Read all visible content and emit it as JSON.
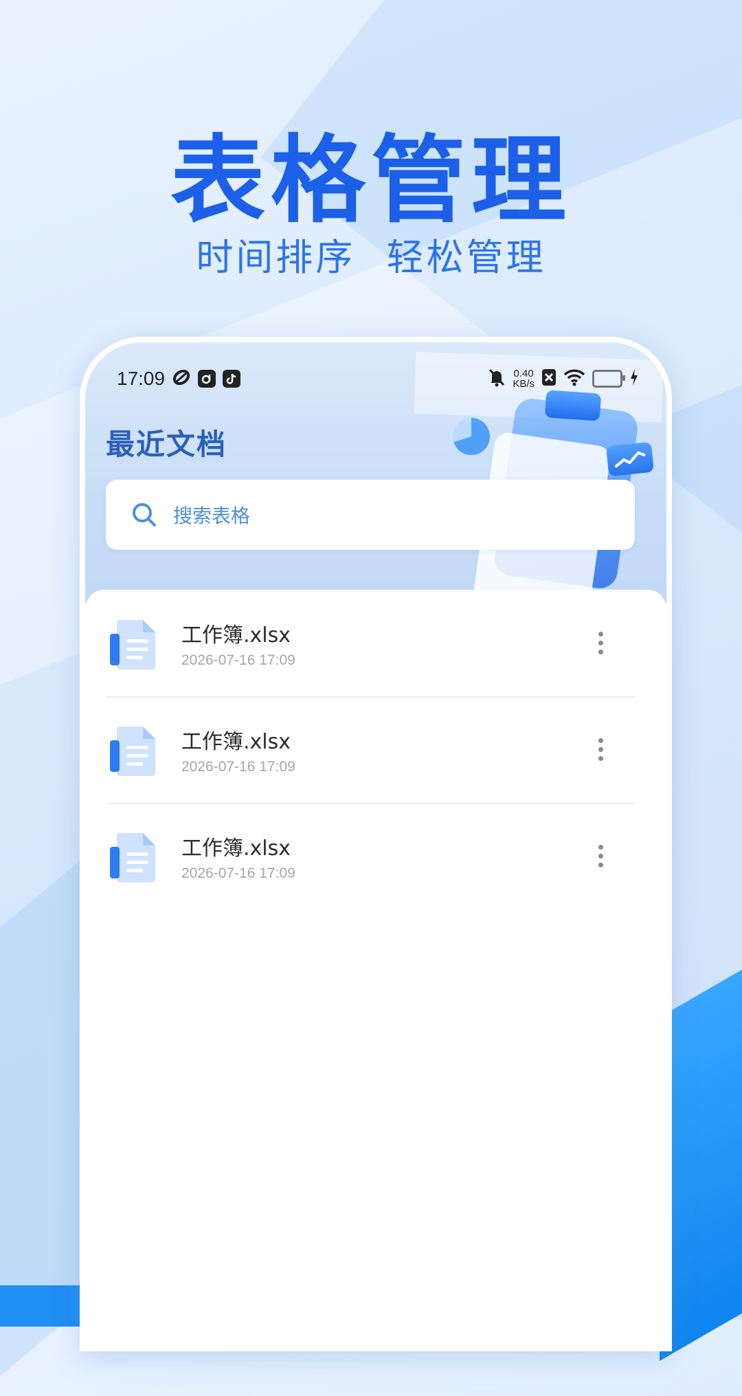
{
  "promo": {
    "headline": "表格管理",
    "subline": "时间排序  轻松管理"
  },
  "status_bar": {
    "time": "17:09",
    "net_speed_value": "0.40",
    "net_speed_unit": "KB/s",
    "icons": [
      "sync-icon",
      "app-icon",
      "tiktok-icon",
      "mute-icon",
      "sim-icon",
      "wifi-icon",
      "battery-icon",
      "charging-icon"
    ]
  },
  "page": {
    "title": "最近文档"
  },
  "search": {
    "placeholder": "搜索表格"
  },
  "files": [
    {
      "name": "工作簿.xlsx",
      "date": "2026-07-16 17:09"
    },
    {
      "name": "工作簿.xlsx",
      "date": "2026-07-16 17:09"
    },
    {
      "name": "工作簿.xlsx",
      "date": "2026-07-16 17:09"
    }
  ],
  "colors": {
    "accent": "#1c5fe8",
    "title": "#2a5fbd",
    "placeholder": "#4d8fdc",
    "date": "#a6a6a6"
  }
}
